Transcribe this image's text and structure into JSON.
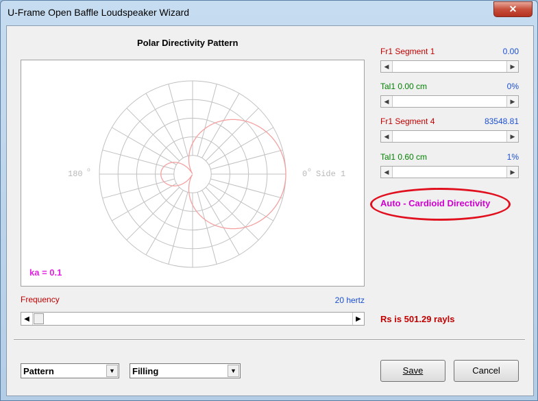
{
  "window": {
    "title": "U-Frame Open Baffle Loudspeaker Wizard",
    "close_label": "✕"
  },
  "plot": {
    "title": "Polar Directivity Pattern",
    "label_left": "180",
    "label_right": "0",
    "label_side": "Side 1",
    "ka_text": "ka = 0.1",
    "pattern": "cardioid",
    "grid_color": "#c0c0c0",
    "curve_color": "#f4a0a0"
  },
  "frequency": {
    "label": "Frequency",
    "value_text": "20 hertz"
  },
  "controls": [
    {
      "label": "Fr1  Segment 1",
      "value": "0.00",
      "label_color": "red"
    },
    {
      "label": "Tal1  0.00 cm",
      "value": "0%",
      "label_color": "green"
    },
    {
      "label": "Fr1  Segment 4",
      "value": "83548.81",
      "label_color": "red"
    },
    {
      "label": "Tal1  0.60 cm",
      "value": "1%",
      "label_color": "green"
    }
  ],
  "status": {
    "mode": "Auto - Cardioid Directivity",
    "rs": "Rs is 501.29 rayls"
  },
  "combos": {
    "left": "Pattern",
    "right": "Filling"
  },
  "buttons": {
    "save": "Save",
    "cancel": "Cancel"
  },
  "colors": {
    "accent_red": "#c00000",
    "accent_green": "#008000",
    "value_blue": "#1a4fd0",
    "highlight_magenta": "#d000d0",
    "annotation_red": "#e0101f"
  }
}
